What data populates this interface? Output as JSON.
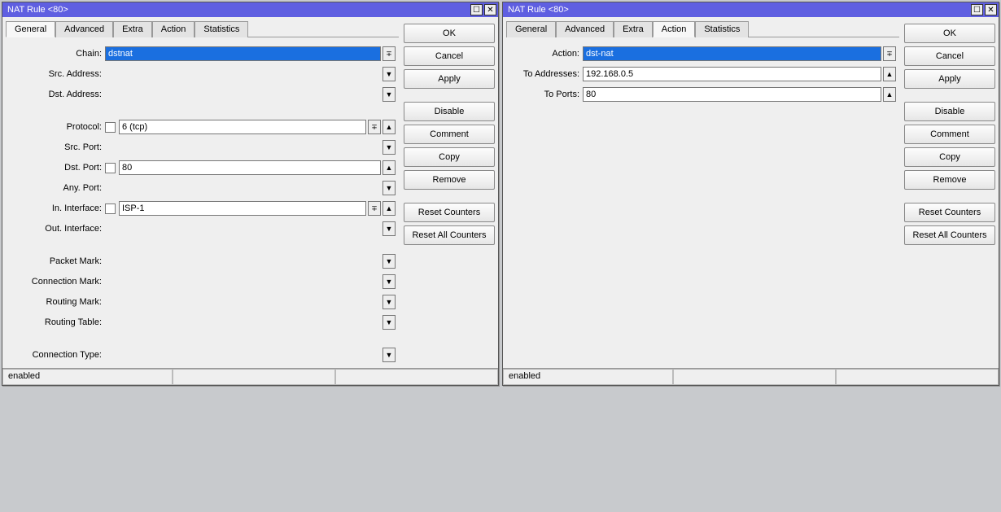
{
  "windows": [
    {
      "title": "NAT Rule <80>",
      "tabs": [
        "General",
        "Advanced",
        "Extra",
        "Action",
        "Statistics"
      ],
      "active_tab": "General",
      "status": "enabled",
      "buttons": {
        "ok": "OK",
        "cancel": "Cancel",
        "apply": "Apply",
        "disable": "Disable",
        "comment": "Comment",
        "copy": "Copy",
        "remove": "Remove",
        "reset": "Reset Counters",
        "reset_all": "Reset All Counters"
      },
      "fields": {
        "chain": {
          "label": "Chain:",
          "value": "dstnat",
          "selected": true,
          "dropdown": true
        },
        "src_addr": {
          "label": "Src. Address:"
        },
        "dst_addr": {
          "label": "Dst. Address:"
        },
        "protocol": {
          "label": "Protocol:",
          "value": "6 (tcp)",
          "checkbox": true,
          "dropdown": true,
          "up": true
        },
        "src_port": {
          "label": "Src. Port:"
        },
        "dst_port": {
          "label": "Dst. Port:",
          "value": "80",
          "checkbox": true,
          "up": true
        },
        "any_port": {
          "label": "Any. Port:"
        },
        "in_iface": {
          "label": "In. Interface:",
          "value": "ISP-1",
          "checkbox": true,
          "dropdown": true,
          "up": true
        },
        "out_iface": {
          "label": "Out. Interface:"
        },
        "packet_mark": {
          "label": "Packet Mark:"
        },
        "conn_mark": {
          "label": "Connection Mark:"
        },
        "routing_mark": {
          "label": "Routing Mark:"
        },
        "routing_table": {
          "label": "Routing Table:"
        },
        "conn_type": {
          "label": "Connection Type:"
        }
      }
    },
    {
      "title": "NAT Rule <80>",
      "tabs": [
        "General",
        "Advanced",
        "Extra",
        "Action",
        "Statistics"
      ],
      "active_tab": "Action",
      "status": "enabled",
      "buttons": {
        "ok": "OK",
        "cancel": "Cancel",
        "apply": "Apply",
        "disable": "Disable",
        "comment": "Comment",
        "copy": "Copy",
        "remove": "Remove",
        "reset": "Reset Counters",
        "reset_all": "Reset All Counters"
      },
      "fields": {
        "action": {
          "label": "Action:",
          "value": "dst-nat",
          "selected": true,
          "dropdown": true
        },
        "to_addr": {
          "label": "To Addresses:",
          "value": "192.168.0.5",
          "up": true
        },
        "to_ports": {
          "label": "To Ports:",
          "value": "80",
          "up": true
        }
      }
    }
  ],
  "glyph": {
    "down": "▼",
    "up": "▲",
    "dd": "∓",
    "close": "✕",
    "max": "☐"
  }
}
